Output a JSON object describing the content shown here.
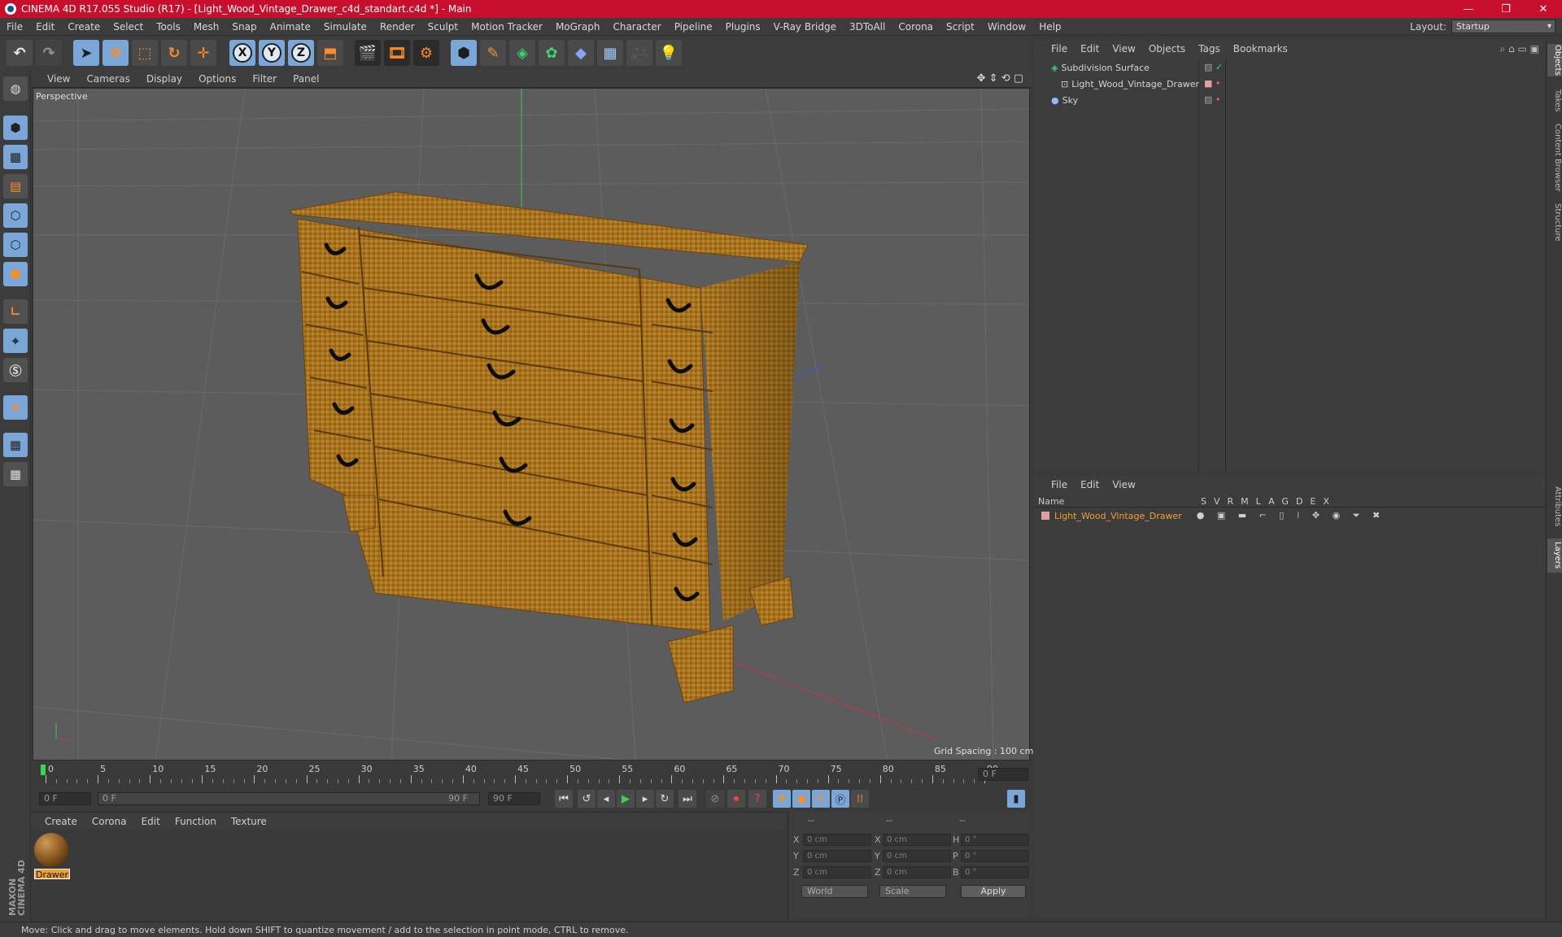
{
  "window": {
    "title": "CINEMA 4D R17.055 Studio (R17) - [Light_Wood_Vintage_Drawer_c4d_standart.c4d *] - Main",
    "minimize": "—",
    "restore": "❐",
    "close": "✕"
  },
  "menubar": {
    "items": [
      "File",
      "Edit",
      "Create",
      "Select",
      "Tools",
      "Mesh",
      "Snap",
      "Animate",
      "Simulate",
      "Render",
      "Sculpt",
      "Motion Tracker",
      "MoGraph",
      "Character",
      "Pipeline",
      "Plugins",
      "V-Ray Bridge",
      "3DToAll",
      "Corona",
      "Script",
      "Window",
      "Help"
    ],
    "layout_label": "Layout:",
    "layout_value": "Startup"
  },
  "toolbar": {
    "x_axis": "X",
    "y_axis": "Y",
    "z_axis": "Z"
  },
  "viewport": {
    "menu": [
      "View",
      "Cameras",
      "Display",
      "Options",
      "Filter",
      "Panel"
    ],
    "label": "Perspective",
    "grid_spacing": "Grid Spacing : 100 cm"
  },
  "timeline": {
    "ticks": [
      "0",
      "5",
      "10",
      "15",
      "20",
      "25",
      "30",
      "35",
      "40",
      "45",
      "50",
      "55",
      "60",
      "65",
      "70",
      "75",
      "80",
      "85",
      "90"
    ],
    "current_frame": "0 F",
    "start_field": "0 F",
    "range_start": "0 F",
    "range_end": "90 F",
    "end_field": "90 F"
  },
  "material_manager": {
    "menu": [
      "Create",
      "Corona",
      "Edit",
      "Function",
      "Texture"
    ],
    "materials": [
      {
        "name": "Drawer"
      }
    ]
  },
  "coordinates": {
    "header": [
      "--",
      "--",
      "--"
    ],
    "rows": [
      {
        "a": "X",
        "av": "0 cm",
        "b": "X",
        "bv": "0 cm",
        "c": "H",
        "cv": "0 °"
      },
      {
        "a": "Y",
        "av": "0 cm",
        "b": "Y",
        "bv": "0 cm",
        "c": "P",
        "cv": "0 °"
      },
      {
        "a": "Z",
        "av": "0 cm",
        "b": "Z",
        "bv": "0 cm",
        "c": "B",
        "cv": "0 °"
      }
    ],
    "mode": "World",
    "size_mode": "Scale",
    "apply": "Apply"
  },
  "object_manager": {
    "menu": [
      "File",
      "Edit",
      "View",
      "Objects",
      "Tags",
      "Bookmarks"
    ],
    "objects": [
      {
        "name": "Subdivision Surface"
      },
      {
        "name": "Light_Wood_Vintage_Drawer"
      },
      {
        "name": "Sky"
      }
    ]
  },
  "layer_manager": {
    "menu": [
      "File",
      "Edit",
      "View"
    ],
    "name_header": "Name",
    "columns": [
      "S",
      "V",
      "R",
      "M",
      "L",
      "A",
      "G",
      "D",
      "E",
      "X"
    ],
    "layers": [
      {
        "name": "Light_Wood_Vintage_Drawer"
      }
    ]
  },
  "right_tabs": [
    "Objects",
    "Takes",
    "Content Browser",
    "Structure",
    "Attributes",
    "Layers"
  ],
  "maxon_logo": "MAXON CINEMA 4D",
  "status": "Move: Click and drag to move elements. Hold down SHIFT to quantize movement / add to the selection in point mode, CTRL to remove.",
  "colors": {
    "title_bar": "#c8102e",
    "accent_orange": "#ff8c2a",
    "tool_blue": "#7aa7d8",
    "layer_name": "#f0a030"
  }
}
